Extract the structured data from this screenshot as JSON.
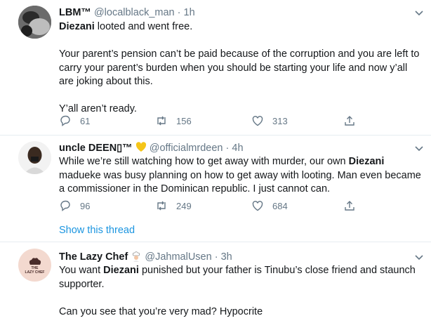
{
  "tweets": [
    {
      "name": "LBM™",
      "handle": "@localblack_man",
      "time": "1h",
      "paragraphs": [
        {
          "bold": "Diezani",
          "text": " looted and went free."
        },
        {
          "bold": "",
          "text": "Your parent’s pension can’t be paid because of the corruption and you are left to carry your parent’s burden when you should be starting your life and now y’all are joking about this."
        },
        {
          "bold": "",
          "text": "Y’all aren’t ready."
        }
      ],
      "replies": "61",
      "retweets": "156",
      "likes": "313"
    },
    {
      "name": "uncle DEEN▯™",
      "handle": "@officialmrdeen",
      "time": "4h",
      "body_pre": "While we’re still watching how to get away with murder, our own ",
      "body_bold": "Diezani",
      "body_post": " madueke was busy planning on how to get away with looting. Man even became a commissioner in the Dominican republic. I just cannot can.",
      "replies": "96",
      "retweets": "249",
      "likes": "684"
    },
    {
      "name": "The Lazy Chef",
      "handle": "@JahmalUsen",
      "time": "3h",
      "avatar_text_1": "THE",
      "avatar_text_2": "LAZY CHEF",
      "body_pre": "You want ",
      "body_bold": "Diezani",
      "body_post": " punished but your father is Tinubu’s close friend and staunch supporter.",
      "paragraph2": "Can you see that you’re very mad? Hypocrite"
    }
  ],
  "show_thread": "Show this thread",
  "separator": "·",
  "colors": {
    "link": "#1b95e0",
    "muted": "#657786",
    "text": "#14171a",
    "divider": "#e6ecf0",
    "heart_emoji": "#f5c518"
  },
  "icons": [
    "reply-icon",
    "retweet-icon",
    "like-icon",
    "share-icon",
    "caret-down-icon",
    "yellow-heart-icon",
    "chef-emoji-icon"
  ]
}
